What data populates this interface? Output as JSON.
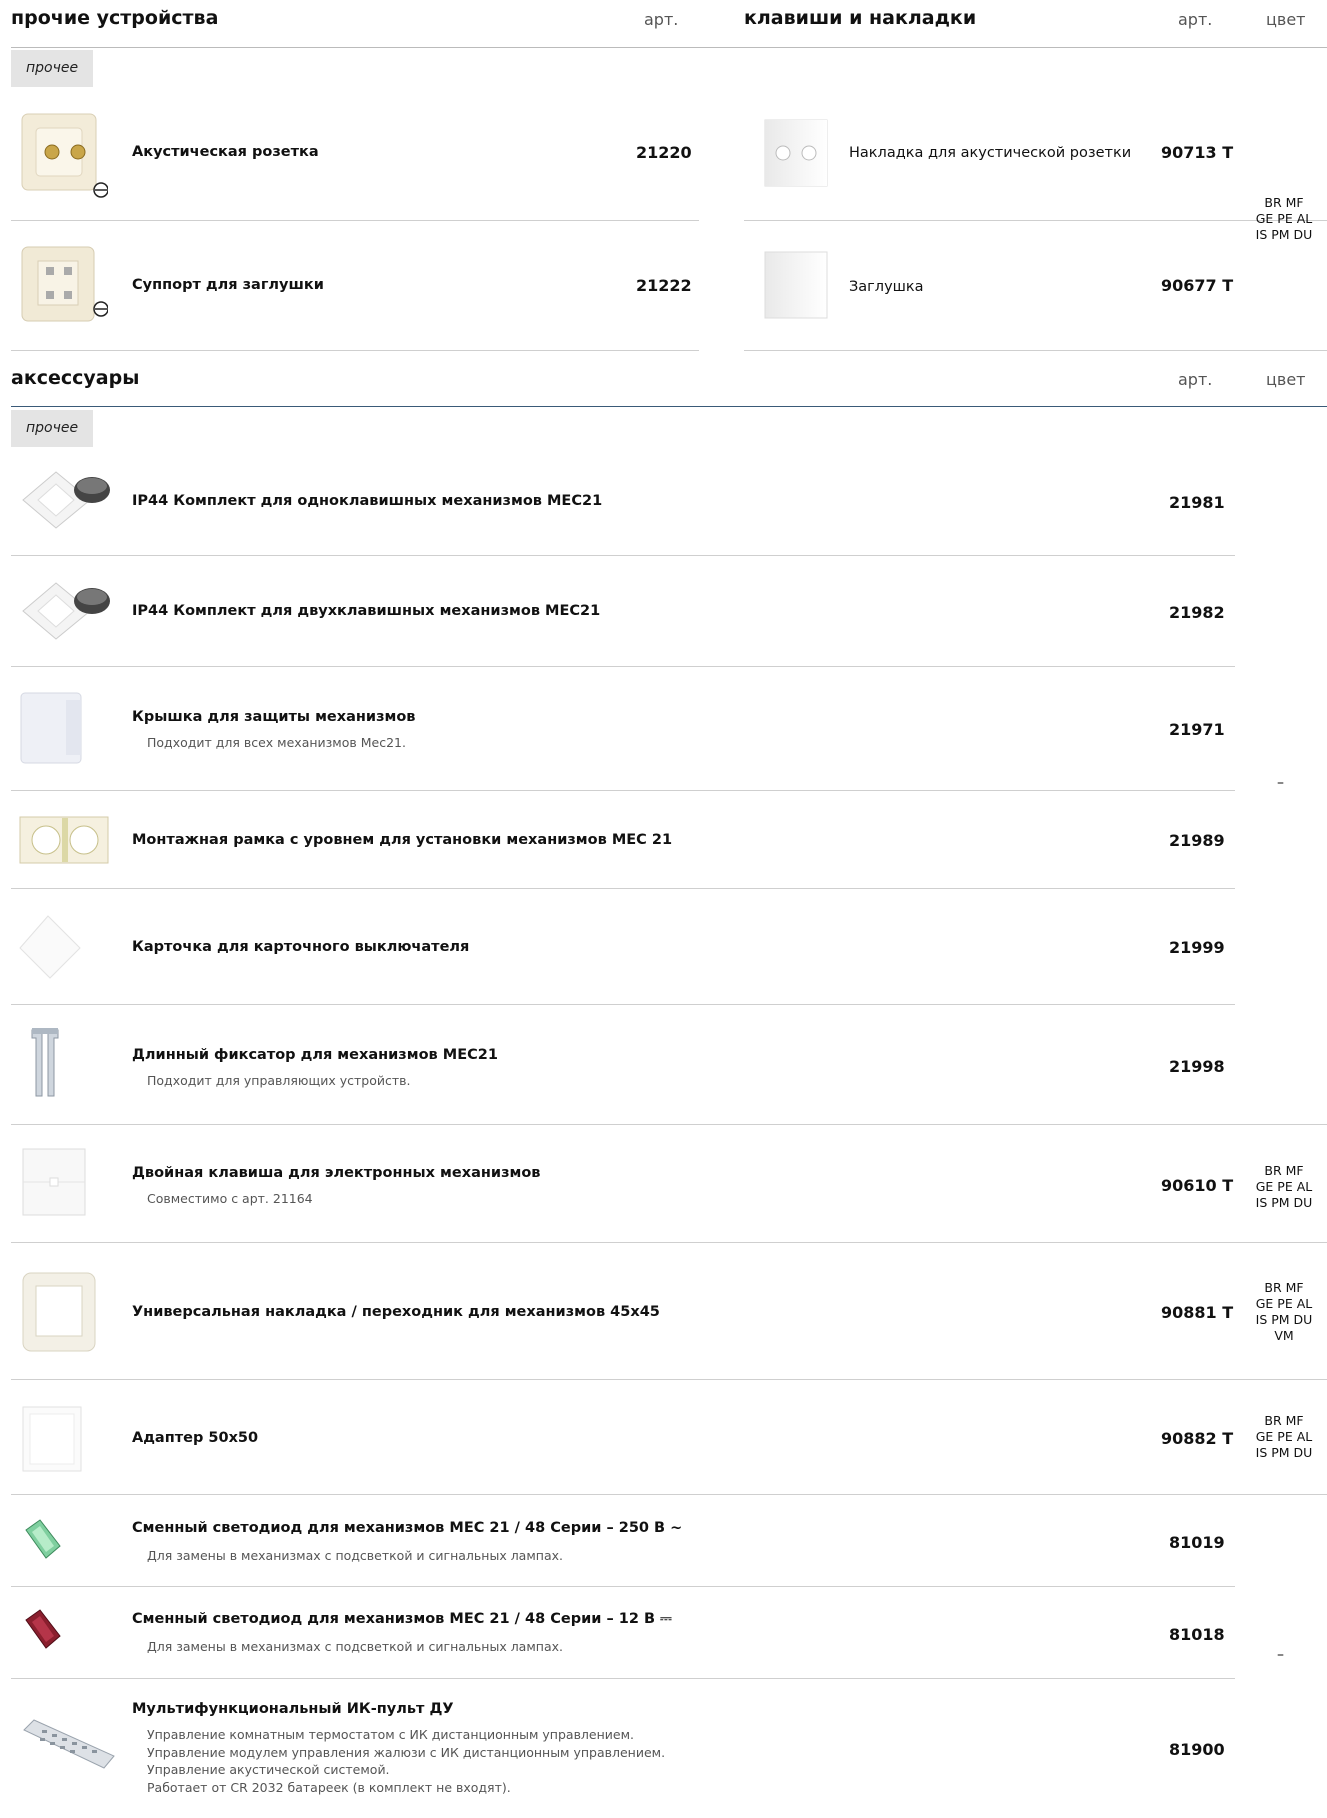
{
  "top": {
    "left_header": "прочие устройства",
    "left_art_label": "арт.",
    "right_header": "клавиши и накладки",
    "right_art_label": "арт.",
    "right_color_label": "цвет",
    "tag": "прочее",
    "rows": [
      {
        "left_name": "Акустическая розетка",
        "left_art": "21220",
        "right_name": "Накладка для акустической розетки",
        "right_art": "90713 T"
      },
      {
        "left_name": "Суппорт для заглушки",
        "left_art": "21222",
        "right_name": "Заглушка",
        "right_art": "90677 T"
      }
    ],
    "colors": [
      "BR MF",
      "GE PE AL",
      "IS PM DU"
    ]
  },
  "accessories": {
    "header": "аксессуары",
    "art_label": "арт.",
    "color_label": "цвет",
    "tag": "прочее",
    "items": [
      {
        "name": "IP44 Комплект для одноклавишных механизмов MEC21",
        "art": "21981"
      },
      {
        "name": "IP44 Комплект для двухклавишных механизмов MEC21",
        "art": "21982"
      },
      {
        "name": "Крышка для защиты механизмов",
        "desc": "Подходит для всех механизмов Mec21.",
        "art": "21971"
      },
      {
        "name": "Монтажная рамка с уровнем для установки механизмов MEC 21",
        "art": "21989"
      },
      {
        "name": "Карточка для карточного выключателя",
        "art": "21999"
      },
      {
        "name": "Длинный фиксатор для механизмов MEC21",
        "desc": "Подходит для управляющих устройств.",
        "art": "21998"
      },
      {
        "name": "Двойная клавиша для электронных механизмов",
        "desc": "Совместимо с арт. 21164",
        "art": "90610 T",
        "colors": [
          "BR MF",
          "GE PE AL",
          "IS PM DU"
        ]
      },
      {
        "name": "Универсальная накладка / переходник для механизмов 45х45",
        "art": "90881 T",
        "colors": [
          "BR MF",
          "GE PE AL",
          "IS PM DU",
          "VM"
        ]
      },
      {
        "name": "Адаптер 50х50",
        "art": "90882 T",
        "colors": [
          "BR MF",
          "GE PE AL",
          "IS PM DU"
        ]
      },
      {
        "name": "Сменный светодиод для механизмов MEC 21 / 48 Серии – 250 B ~",
        "desc": "Для замены в механизмах с подсветкой и сигнальных лампах.",
        "art": "81019"
      },
      {
        "name": "Сменный светодиод для механизмов MEC 21 / 48 Серии – 12 B ⎓",
        "desc": "Для замены в механизмах с подсветкой и сигнальных лампах.",
        "art": "81018"
      },
      {
        "name": "Мультифункциональный ИК-пульт ДУ",
        "desc_lines": [
          "Управление комнатным термостатом с ИК дистанционным управлением.",
          "Управление модулем управления жалюзи с ИК дистанционным управлением.",
          "Управление акустической системой.",
          "Работает от CR 2032 батареек (в комплект не входят)."
        ],
        "art": "81900"
      }
    ],
    "dash_1": "–",
    "dash_2": "–"
  }
}
